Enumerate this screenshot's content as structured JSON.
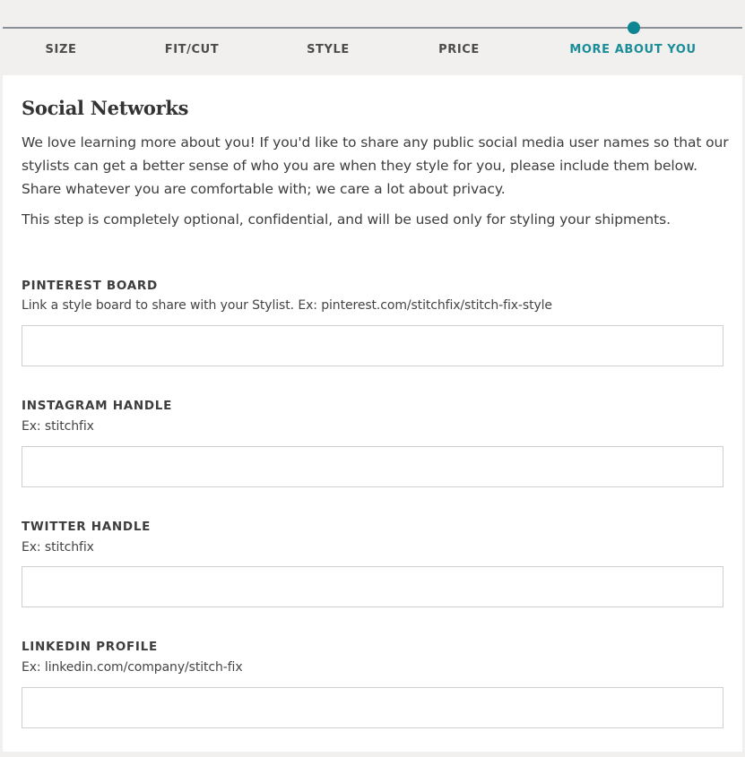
{
  "progress": {
    "steps": [
      {
        "label": "SIZE",
        "active": false
      },
      {
        "label": "FIT/CUT",
        "active": false
      },
      {
        "label": "STYLE",
        "active": false
      },
      {
        "label": "PRICE",
        "active": false
      },
      {
        "label": "MORE ABOUT YOU",
        "active": true
      }
    ],
    "current_step": 5,
    "total_steps": 5,
    "accent_color": "#0f8591"
  },
  "section": {
    "title": "Social Networks",
    "intro_paragraphs": [
      "We love learning more about you! If you'd like to share any public social media user names so that our stylists can get a better sense of who you are when they style for you, please include them below. Share whatever you are comfortable with; we care a lot about privacy.",
      "This step is completely optional, confidential, and will be used only for styling your shipments."
    ]
  },
  "fields": [
    {
      "label": "PINTEREST BOARD",
      "hint": "Link a style board to share with your Stylist. Ex: pinterest.com/stitchfix/stitch-fix-style",
      "value": "",
      "placeholder": ""
    },
    {
      "label": "INSTAGRAM HANDLE",
      "hint": "Ex: stitchfix",
      "value": "",
      "placeholder": ""
    },
    {
      "label": "TWITTER HANDLE",
      "hint": "Ex: stitchfix",
      "value": "",
      "placeholder": ""
    },
    {
      "label": "LINKEDIN PROFILE",
      "hint": "Ex: linkedin.com/company/stitch-fix",
      "value": "",
      "placeholder": ""
    }
  ]
}
